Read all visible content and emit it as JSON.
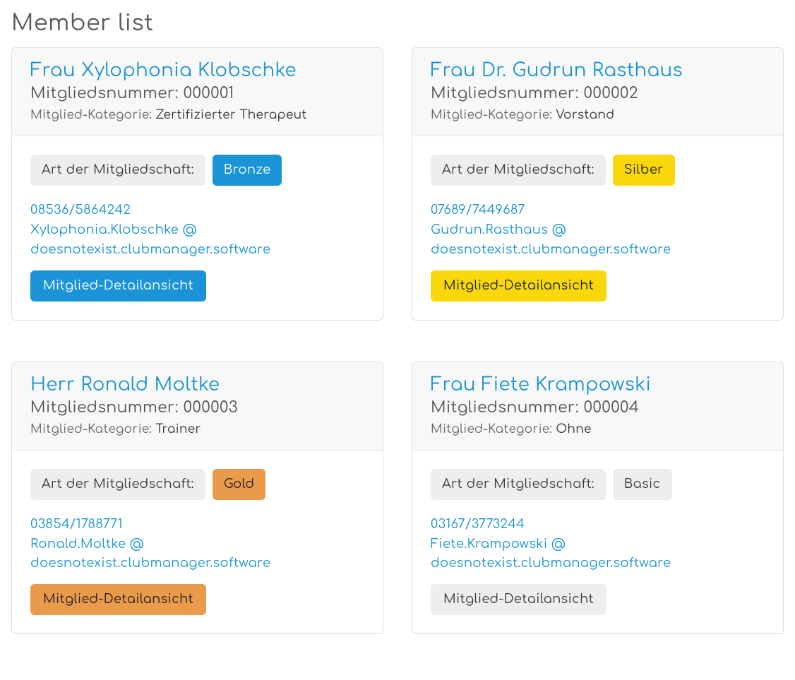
{
  "page": {
    "title": "Member list"
  },
  "labels": {
    "member_number_prefix": "Mitgliedsnummer: ",
    "category_prefix": "Mitglied-Kategorie: ",
    "membership_type_label": "Art der Mitgliedschaft:",
    "detail_button": "Mitglied-Detailansicht"
  },
  "members": [
    {
      "name": "Frau Xylophonia Klobschke",
      "number": "000001",
      "category": "Zertifizierter Therapeut",
      "membership_type": "Bronze",
      "membership_class": "bronze",
      "phone": "08536/5864242",
      "email": "Xylophonia.Klobschke @ doesnotexist.clubmanager.software"
    },
    {
      "name": "Frau Dr.  Gudrun Rasthaus",
      "number": "000002",
      "category": "Vorstand",
      "membership_type": "Silber",
      "membership_class": "silber",
      "phone": "07689/7449687",
      "email": "Gudrun.Rasthaus @ doesnotexist.clubmanager.software"
    },
    {
      "name": "Herr Ronald Moltke",
      "number": "000003",
      "category": "Trainer",
      "membership_type": "Gold",
      "membership_class": "gold",
      "phone": "03854/1788771",
      "email": "Ronald.Moltke @ doesnotexist.clubmanager.software"
    },
    {
      "name": "Frau Fiete Krampowski",
      "number": "000004",
      "category": "Ohne",
      "membership_type": "Basic",
      "membership_class": "basic",
      "phone": "03167/3773244",
      "email": "Fiete.Krampowski @ doesnotexist.clubmanager.software"
    }
  ]
}
